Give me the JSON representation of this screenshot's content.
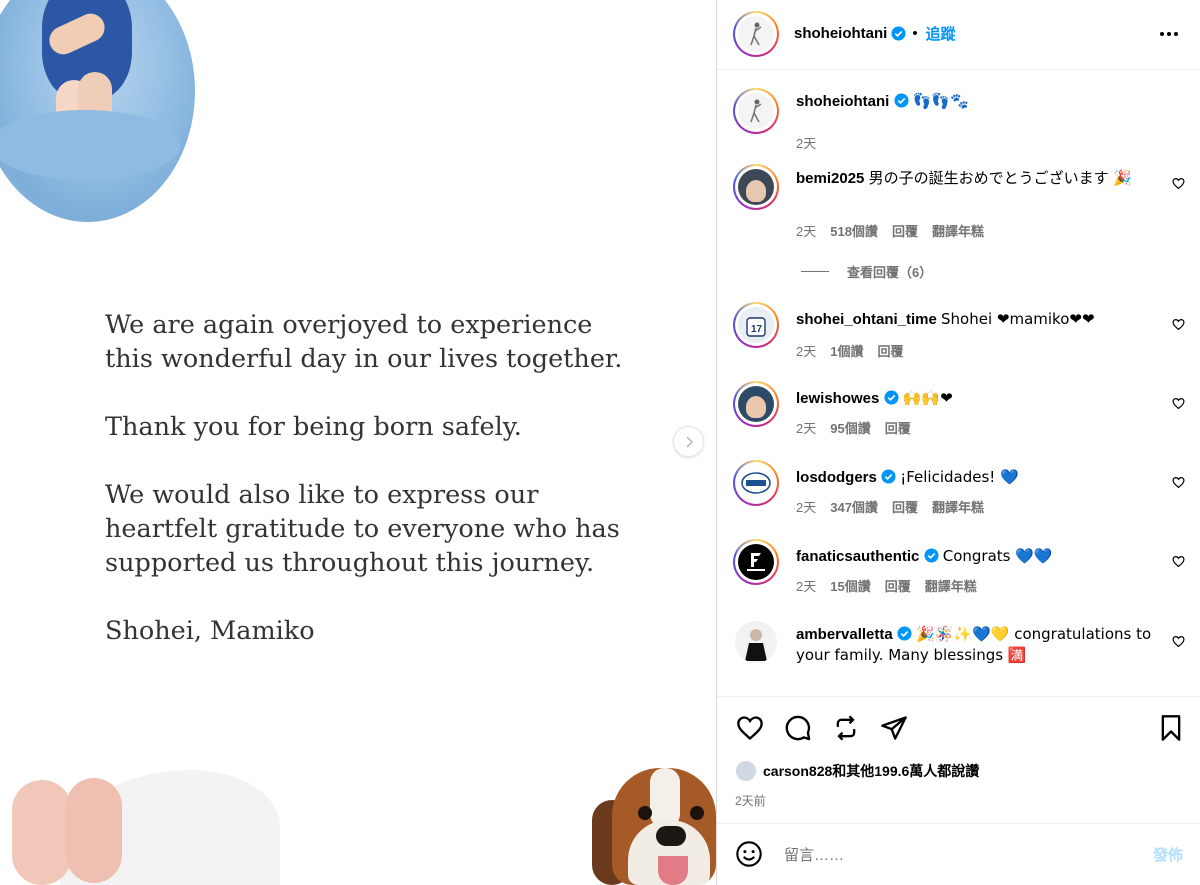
{
  "post_image": {
    "caption_lines": [
      "We are again overjoyed to experience\nthis wonderful day in our lives together.",
      "Thank you for being born safely.",
      "We would also like to express our\nheartfelt gratitude to everyone who has\nsupported us throughout this journey.",
      "Shohei, Mamiko"
    ]
  },
  "header": {
    "username": "shoheiohtani",
    "separator": "•",
    "follow_label": "追蹤"
  },
  "caption": {
    "username": "shoheiohtani",
    "text": "👣👣🐾",
    "time": "2天"
  },
  "comments": [
    {
      "username": "bemi2025",
      "text": "男の子の誕生おめでとうございます 🎉",
      "time": "2天",
      "likes": "518個讚",
      "reply": "回覆",
      "translate": "翻譯年糕",
      "view_replies": "查看回覆（6）"
    },
    {
      "username": "shohei_ohtani_time",
      "text": "Shohei ❤mamiko❤❤",
      "time": "2天",
      "likes": "1個讚",
      "reply": "回覆"
    },
    {
      "username": "lewishowes",
      "text": "🙌🙌❤",
      "time": "2天",
      "likes": "95個讚",
      "reply": "回覆"
    },
    {
      "username": "losdodgers",
      "text": "¡Felicidades! 💙",
      "time": "2天",
      "likes": "347個讚",
      "reply": "回覆",
      "translate": "翻譯年糕"
    },
    {
      "username": "fanaticsauthentic",
      "text": "Congrats 💙💙",
      "time": "2天",
      "likes": "15個讚",
      "reply": "回覆",
      "translate": "翻譯年糕"
    },
    {
      "username": "ambervalletta",
      "text": "🎉🪅✨💙💛 congratulations to your family. Many blessings 🈵"
    }
  ],
  "likes_summary": "carson828和其他199.6萬人都說讚",
  "post_time": "2天前",
  "comment_input": {
    "placeholder": "留言……",
    "post_label": "發佈"
  },
  "colors": {
    "follow": "#0095f6",
    "verified": "#0095f6",
    "muted": "#737373",
    "post_button_disabled": "#b2dffc"
  }
}
